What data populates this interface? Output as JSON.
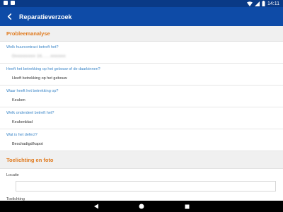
{
  "status_bar": {
    "time": "14:11"
  },
  "app_bar": {
    "title": "Reparatieverzoek"
  },
  "section_problem": {
    "title": "Probleemanalyse",
    "questions": [
      {
        "label": "Welk huurcontract betreft het?",
        "answer": "Onnnnnnnn 16......nnnnnn"
      },
      {
        "label": "Heeft het betrekking op het gebouw of de daarbinnen?",
        "answer": "Heeft betrekking op het gebouw"
      },
      {
        "label": "Waar heeft het betrekking op?",
        "answer": "Keuken"
      },
      {
        "label": "Welk onderdeel betreft het?",
        "answer": "Keukenblad"
      },
      {
        "label": "Wat is het defect?",
        "answer": "Beschadigd/kapot"
      }
    ]
  },
  "section_explanation": {
    "title": "Toelichting en foto",
    "location_label": "Locatie",
    "location_value": "",
    "explanation_label": "Toelichting"
  }
}
